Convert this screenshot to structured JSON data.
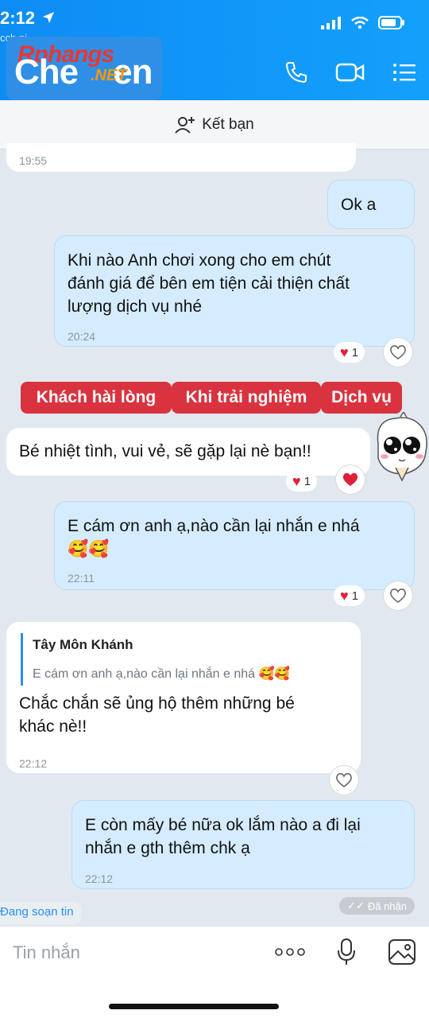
{
  "status": {
    "time": "2:12",
    "sub": "cch ni"
  },
  "logo": {
    "top": "Rphangs",
    "main": "Che",
    "net": ".NET",
    "tail": "en"
  },
  "friend_bar": {
    "label": "Kết bạn"
  },
  "messages": {
    "prev_time": "19:55",
    "ok": "Ok a",
    "m1": [
      "Khi nào Anh chơi xong cho em chút",
      "đánh giá để bên em tiện cải thiện chất",
      "lượng dịch vụ nhé"
    ],
    "m1_time": "20:24",
    "m1_react_count": "1",
    "banners": [
      "Khách hài lòng",
      "Khi trải nghiệm",
      "Dịch vụ"
    ],
    "m2": "Bé nhiệt tình, vui vẻ, sẽ gặp lại nè bạn!!",
    "m2_react_count": "1",
    "m3_line1": "E cám ơn anh ạ,nào cần lại nhắn e nhá",
    "m3_emoji": "🥰🥰",
    "m3_time": "22:11",
    "m3_react_count": "1",
    "quote_name": "Tây Môn Khánh",
    "quote_text": "E cám ơn anh ạ,nào cần lại nhắn e nhá 🥰🥰",
    "m4": [
      "Chắc chắn sẽ ủng hộ thêm những bé",
      "khác nè!!"
    ],
    "m4_time": "22:12",
    "m5": [
      "E còn mấy bé nữa ok lắm nào a đi lại",
      "nhắn e gth thêm chk ạ"
    ],
    "m5_time": "22:12",
    "typing": "Đang soạn tin",
    "seen": "Đã nhận"
  },
  "input": {
    "placeholder": "Tin nhắn"
  },
  "colors": {
    "header": "#0d8cf5",
    "outgoing": "#d5ecff",
    "banner": "#d9333f",
    "heart": "#e0203a"
  }
}
